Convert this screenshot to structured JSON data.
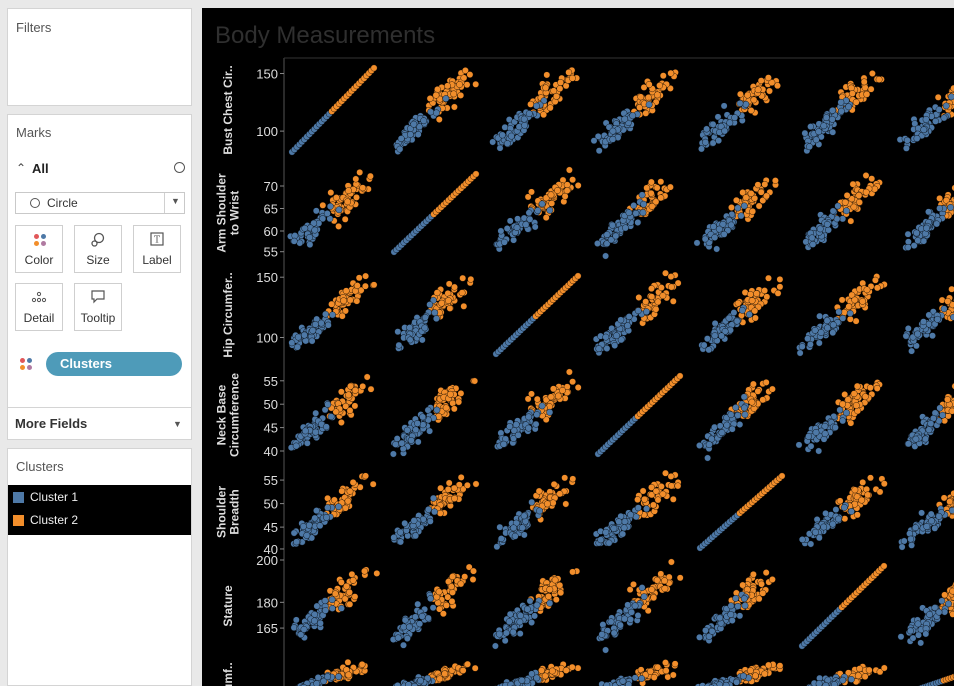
{
  "sidebar": {
    "filters": {
      "title": "Filters"
    },
    "marks": {
      "title": "Marks",
      "all_label": "All",
      "mark_type": "Circle",
      "tiles": [
        {
          "label": "Color",
          "icon": "color-dots-icon"
        },
        {
          "label": "Size",
          "icon": "size-icon"
        },
        {
          "label": "Label",
          "icon": "label-icon"
        },
        {
          "label": "Detail",
          "icon": "detail-icon"
        },
        {
          "label": "Tooltip",
          "icon": "tooltip-icon"
        }
      ],
      "color_pill": "Clusters",
      "more_fields": "More Fields"
    },
    "legend": {
      "title": "Clusters",
      "items": [
        {
          "label": "Cluster 1",
          "color": "#4e79a7"
        },
        {
          "label": "Cluster 2",
          "color": "#f28e2b"
        }
      ]
    }
  },
  "viz": {
    "title": "Body Measurements",
    "background": "#000000",
    "row_labels": [
      {
        "lines": [
          "Bust Chest Cir.."
        ],
        "ticks": [
          "150",
          "100"
        ]
      },
      {
        "lines": [
          "Arm Shoulder",
          "to Wrist"
        ],
        "ticks": [
          "70",
          "65",
          "60",
          "55"
        ]
      },
      {
        "lines": [
          "Hip Circumfer.."
        ],
        "ticks": [
          "150",
          "100"
        ]
      },
      {
        "lines": [
          "Neck Base",
          "Circumference"
        ],
        "ticks": [
          "55",
          "50",
          "45",
          "40"
        ]
      },
      {
        "lines": [
          "Shoulder",
          "Breadth"
        ],
        "ticks": [
          "55",
          "50",
          "45",
          "40"
        ]
      },
      {
        "lines": [
          "Stature"
        ],
        "ticks": [
          "200",
          "180",
          "165"
        ]
      },
      {
        "lines": [
          "..umf.."
        ],
        "ticks": []
      }
    ]
  },
  "chart_data": {
    "type": "scatter",
    "title": "Body Measurements",
    "subtype": "scatter matrix",
    "dimensions": [
      "Bust Chest Cir..",
      "Arm Shoulder to Wrist",
      "Hip Circumfer..",
      "Neck Base Circumference",
      "Shoulder Breadth",
      "Stature"
    ],
    "series": [
      {
        "name": "Cluster 1",
        "color": "#4e79a7"
      },
      {
        "name": "Cluster 2",
        "color": "#f28e2b"
      }
    ],
    "axis_ranges": {
      "Bust Chest Cir..": [
        80,
        155
      ],
      "Arm Shoulder to Wrist": [
        55,
        72
      ],
      "Hip Circumfer..": [
        85,
        155
      ],
      "Neck Base Circumference": [
        38,
        57
      ],
      "Shoulder Breadth": [
        40,
        56
      ],
      "Stature": [
        150,
        200
      ]
    }
  }
}
